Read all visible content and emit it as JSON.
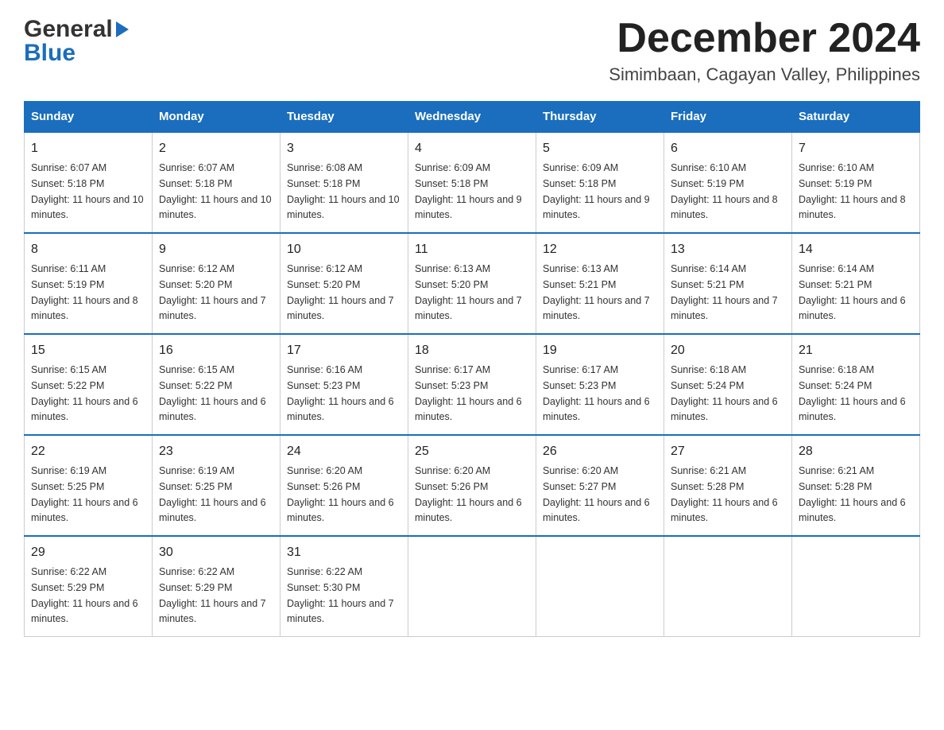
{
  "header": {
    "title": "December 2024",
    "subtitle": "Simimbaan, Cagayan Valley, Philippines",
    "logo_general": "General",
    "logo_blue": "Blue"
  },
  "days_of_week": [
    "Sunday",
    "Monday",
    "Tuesday",
    "Wednesday",
    "Thursday",
    "Friday",
    "Saturday"
  ],
  "weeks": [
    [
      {
        "day": "1",
        "sunrise": "6:07 AM",
        "sunset": "5:18 PM",
        "daylight": "11 hours and 10 minutes."
      },
      {
        "day": "2",
        "sunrise": "6:07 AM",
        "sunset": "5:18 PM",
        "daylight": "11 hours and 10 minutes."
      },
      {
        "day": "3",
        "sunrise": "6:08 AM",
        "sunset": "5:18 PM",
        "daylight": "11 hours and 10 minutes."
      },
      {
        "day": "4",
        "sunrise": "6:09 AM",
        "sunset": "5:18 PM",
        "daylight": "11 hours and 9 minutes."
      },
      {
        "day": "5",
        "sunrise": "6:09 AM",
        "sunset": "5:18 PM",
        "daylight": "11 hours and 9 minutes."
      },
      {
        "day": "6",
        "sunrise": "6:10 AM",
        "sunset": "5:19 PM",
        "daylight": "11 hours and 8 minutes."
      },
      {
        "day": "7",
        "sunrise": "6:10 AM",
        "sunset": "5:19 PM",
        "daylight": "11 hours and 8 minutes."
      }
    ],
    [
      {
        "day": "8",
        "sunrise": "6:11 AM",
        "sunset": "5:19 PM",
        "daylight": "11 hours and 8 minutes."
      },
      {
        "day": "9",
        "sunrise": "6:12 AM",
        "sunset": "5:20 PM",
        "daylight": "11 hours and 7 minutes."
      },
      {
        "day": "10",
        "sunrise": "6:12 AM",
        "sunset": "5:20 PM",
        "daylight": "11 hours and 7 minutes."
      },
      {
        "day": "11",
        "sunrise": "6:13 AM",
        "sunset": "5:20 PM",
        "daylight": "11 hours and 7 minutes."
      },
      {
        "day": "12",
        "sunrise": "6:13 AM",
        "sunset": "5:21 PM",
        "daylight": "11 hours and 7 minutes."
      },
      {
        "day": "13",
        "sunrise": "6:14 AM",
        "sunset": "5:21 PM",
        "daylight": "11 hours and 7 minutes."
      },
      {
        "day": "14",
        "sunrise": "6:14 AM",
        "sunset": "5:21 PM",
        "daylight": "11 hours and 6 minutes."
      }
    ],
    [
      {
        "day": "15",
        "sunrise": "6:15 AM",
        "sunset": "5:22 PM",
        "daylight": "11 hours and 6 minutes."
      },
      {
        "day": "16",
        "sunrise": "6:15 AM",
        "sunset": "5:22 PM",
        "daylight": "11 hours and 6 minutes."
      },
      {
        "day": "17",
        "sunrise": "6:16 AM",
        "sunset": "5:23 PM",
        "daylight": "11 hours and 6 minutes."
      },
      {
        "day": "18",
        "sunrise": "6:17 AM",
        "sunset": "5:23 PM",
        "daylight": "11 hours and 6 minutes."
      },
      {
        "day": "19",
        "sunrise": "6:17 AM",
        "sunset": "5:23 PM",
        "daylight": "11 hours and 6 minutes."
      },
      {
        "day": "20",
        "sunrise": "6:18 AM",
        "sunset": "5:24 PM",
        "daylight": "11 hours and 6 minutes."
      },
      {
        "day": "21",
        "sunrise": "6:18 AM",
        "sunset": "5:24 PM",
        "daylight": "11 hours and 6 minutes."
      }
    ],
    [
      {
        "day": "22",
        "sunrise": "6:19 AM",
        "sunset": "5:25 PM",
        "daylight": "11 hours and 6 minutes."
      },
      {
        "day": "23",
        "sunrise": "6:19 AM",
        "sunset": "5:25 PM",
        "daylight": "11 hours and 6 minutes."
      },
      {
        "day": "24",
        "sunrise": "6:20 AM",
        "sunset": "5:26 PM",
        "daylight": "11 hours and 6 minutes."
      },
      {
        "day": "25",
        "sunrise": "6:20 AM",
        "sunset": "5:26 PM",
        "daylight": "11 hours and 6 minutes."
      },
      {
        "day": "26",
        "sunrise": "6:20 AM",
        "sunset": "5:27 PM",
        "daylight": "11 hours and 6 minutes."
      },
      {
        "day": "27",
        "sunrise": "6:21 AM",
        "sunset": "5:28 PM",
        "daylight": "11 hours and 6 minutes."
      },
      {
        "day": "28",
        "sunrise": "6:21 AM",
        "sunset": "5:28 PM",
        "daylight": "11 hours and 6 minutes."
      }
    ],
    [
      {
        "day": "29",
        "sunrise": "6:22 AM",
        "sunset": "5:29 PM",
        "daylight": "11 hours and 6 minutes."
      },
      {
        "day": "30",
        "sunrise": "6:22 AM",
        "sunset": "5:29 PM",
        "daylight": "11 hours and 7 minutes."
      },
      {
        "day": "31",
        "sunrise": "6:22 AM",
        "sunset": "5:30 PM",
        "daylight": "11 hours and 7 minutes."
      },
      null,
      null,
      null,
      null
    ]
  ],
  "labels": {
    "sunrise": "Sunrise:",
    "sunset": "Sunset:",
    "daylight": "Daylight:"
  }
}
